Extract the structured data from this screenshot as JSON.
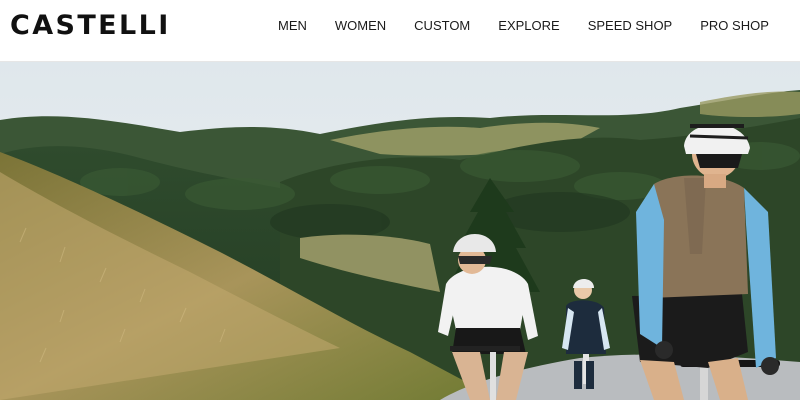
{
  "brand": {
    "logo_text": "CASTELLI"
  },
  "nav": {
    "items": [
      {
        "id": "men",
        "label": "MEN"
      },
      {
        "id": "women",
        "label": "WOMEN"
      },
      {
        "id": "custom",
        "label": "CUSTOM"
      },
      {
        "id": "explore",
        "label": "EXPLORE"
      },
      {
        "id": "speed-shop",
        "label": "SPEED SHOP"
      },
      {
        "id": "pro-shop",
        "label": "PRO SHOP"
      }
    ]
  },
  "hero": {
    "colors": {
      "sky": "#e6ecef",
      "forest": "#2f4a2a",
      "meadow": "#9a8a4c",
      "road": "#b9bcbf",
      "sleeve_blue": "#6fb4dd"
    }
  }
}
